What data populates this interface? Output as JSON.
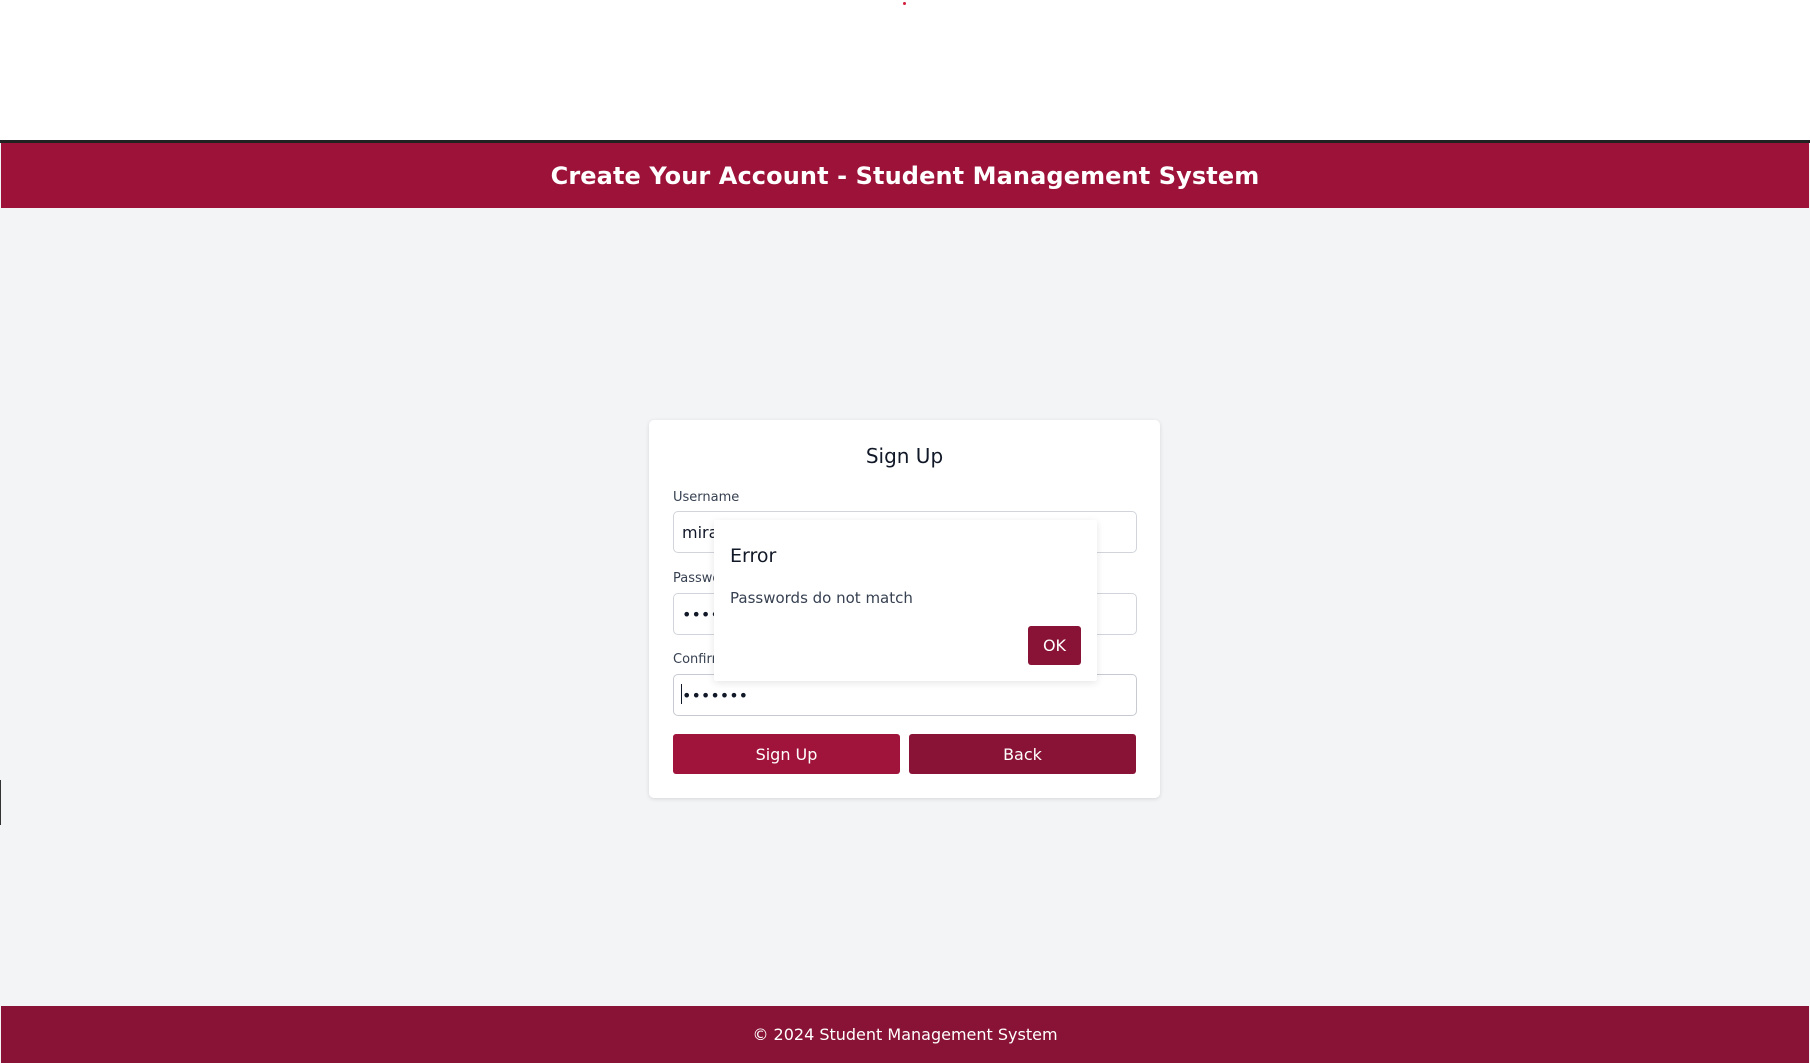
{
  "header": {
    "title": "Create Your Account - Student Management System"
  },
  "form": {
    "title": "Sign Up",
    "username_label": "Username",
    "username_value": "mira",
    "password_label": "Password",
    "password_value": "•••••••",
    "confirm_label": "Confirm Password",
    "confirm_value": "•••••••",
    "signup_label": "Sign Up",
    "back_label": "Back"
  },
  "dialog": {
    "title": "Error",
    "message": "Passwords do not match",
    "ok_label": "OK"
  },
  "footer": {
    "text": "© 2024 Student Management System"
  },
  "colors": {
    "header": "#9d1239",
    "footer": "#891336",
    "primary_button": "#a0133a",
    "secondary_button": "#891336",
    "background": "#f3f4f6"
  }
}
